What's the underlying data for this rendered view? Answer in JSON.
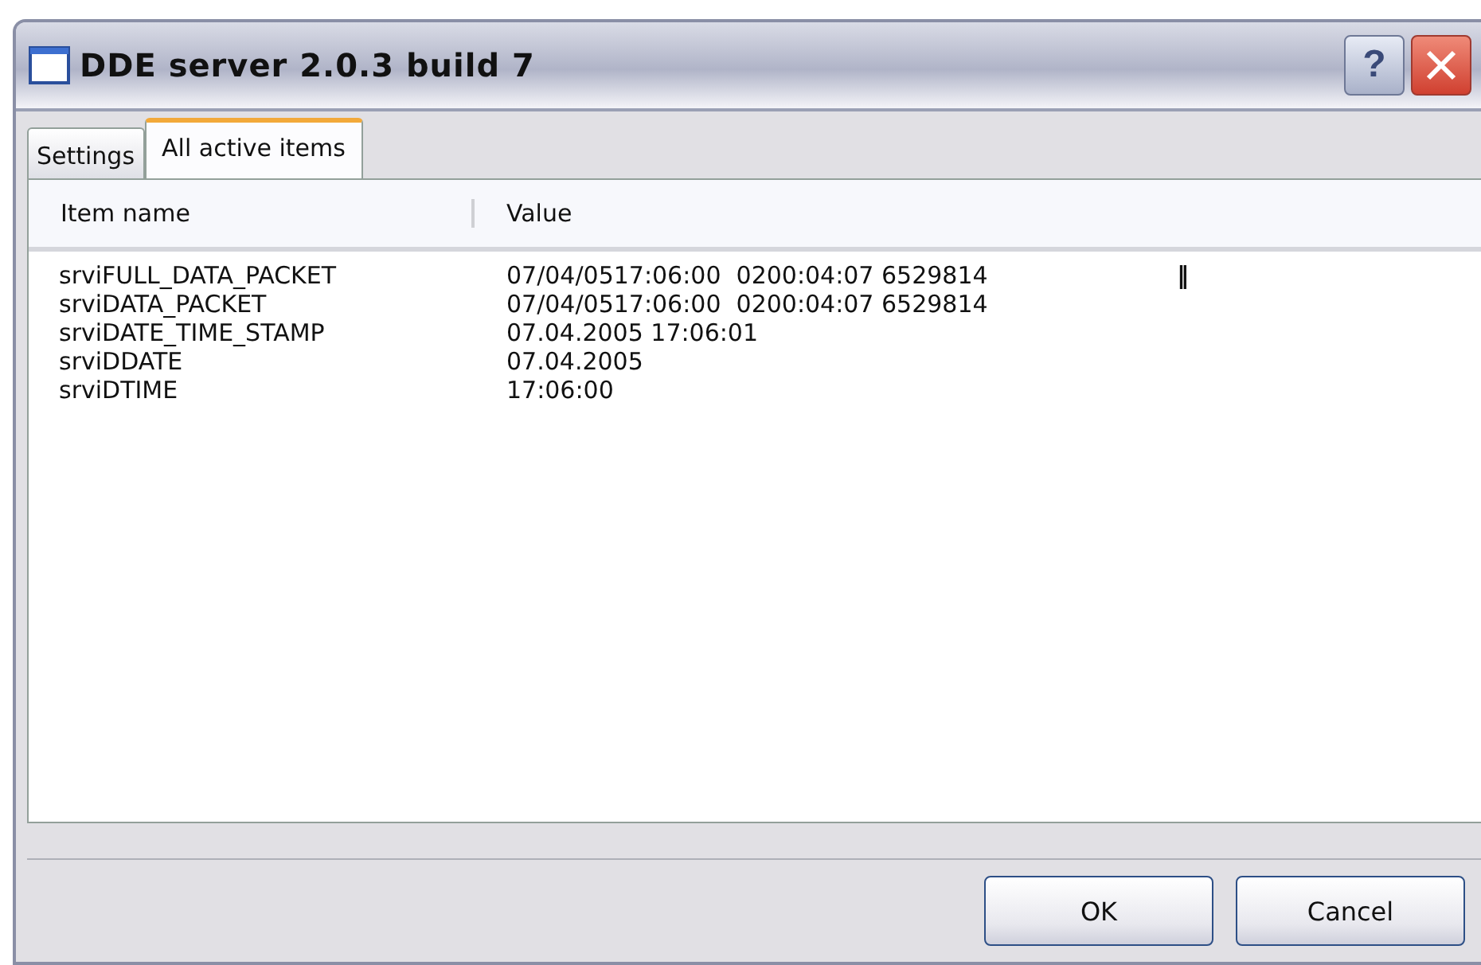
{
  "window": {
    "title": "DDE server 2.0.3 build 7",
    "help_button": "?"
  },
  "tabs": [
    {
      "label": "Settings",
      "selected": false
    },
    {
      "label": "All active items",
      "selected": true
    }
  ],
  "table": {
    "columns": [
      "Item name",
      "Value"
    ],
    "rows": [
      {
        "name": "srviFULL_DATA_PACKET",
        "value": "07/04/0517:06:00  0200:04:07 6529814",
        "suffix": "‖"
      },
      {
        "name": "srviDATA_PACKET",
        "value": "07/04/0517:06:00  0200:04:07 6529814"
      },
      {
        "name": "srviDATE_TIME_STAMP",
        "value": "07.04.2005 17:06:01"
      },
      {
        "name": "srviDDATE",
        "value": "07.04.2005"
      },
      {
        "name": "srviDTIME",
        "value": "17:06:00"
      }
    ]
  },
  "buttons": [
    "OK",
    "Cancel"
  ]
}
